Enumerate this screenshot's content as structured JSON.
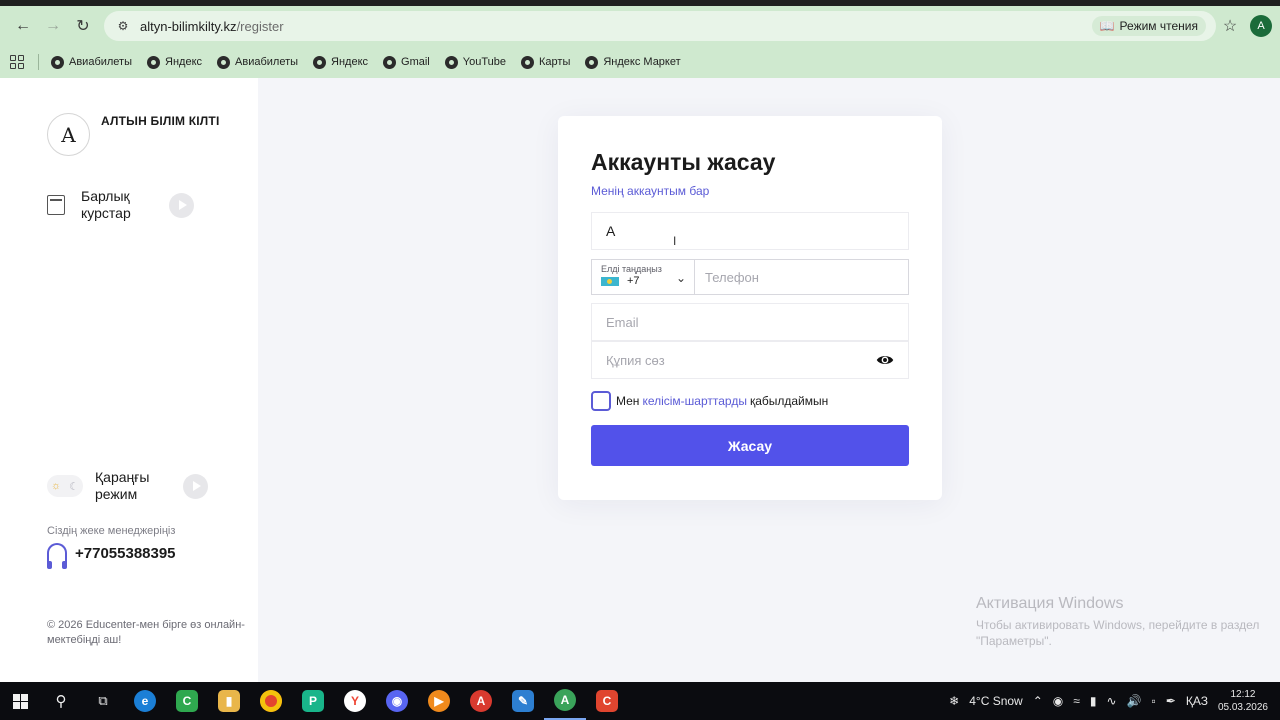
{
  "browser": {
    "url_host": "altyn-bilimkilty.kz",
    "url_path": "/register",
    "reader_label": "Режим чтения",
    "profile_initial": "A",
    "bookmarks": [
      "Авиабилеты",
      "Яндекс",
      "Авиабилеты",
      "Яндекс",
      "Gmail",
      "YouTube",
      "Карты",
      "Яндекс Маркет"
    ]
  },
  "sidebar": {
    "logo_letter": "A",
    "brand": "АЛТЫН БІЛІМ КІЛТІ",
    "courses_label": "Барлық курстар",
    "dark_mode_label": "Қараңғы режим",
    "manager_caption": "Сіздің жеке менеджеріңіз",
    "manager_phone": "+77055388395",
    "copyright": "© 2026 Educenter-мен бірге өз онлайн-мектебіңді аш!"
  },
  "form": {
    "title": "Аккаунты жасау",
    "have_account": "Менің аккаунтым бар",
    "name_value": "A",
    "country_caption": "Елді таңдаңыз",
    "country_code": "+7",
    "phone_placeholder": "Телефон",
    "email_placeholder": "Email",
    "password_placeholder": "Құпия сөз",
    "agree_prefix": "Мен",
    "agree_link": "келісім-шарттарды",
    "agree_suffix": "қабылдаймын",
    "submit_label": "Жасау"
  },
  "watermark": {
    "title": "Активация Windows",
    "subtitle_line1": "Чтобы активировать Windows, перейдите в раздел",
    "subtitle_line2": "\"Параметры\"."
  },
  "taskbar": {
    "weather": "4°C  Snow",
    "language": "ҚАЗ",
    "time": "12:12",
    "date": "05.03.2026"
  },
  "colors": {
    "accent": "#5252ea",
    "link": "#5b5bd6",
    "chrome": "#cfe9cf"
  }
}
